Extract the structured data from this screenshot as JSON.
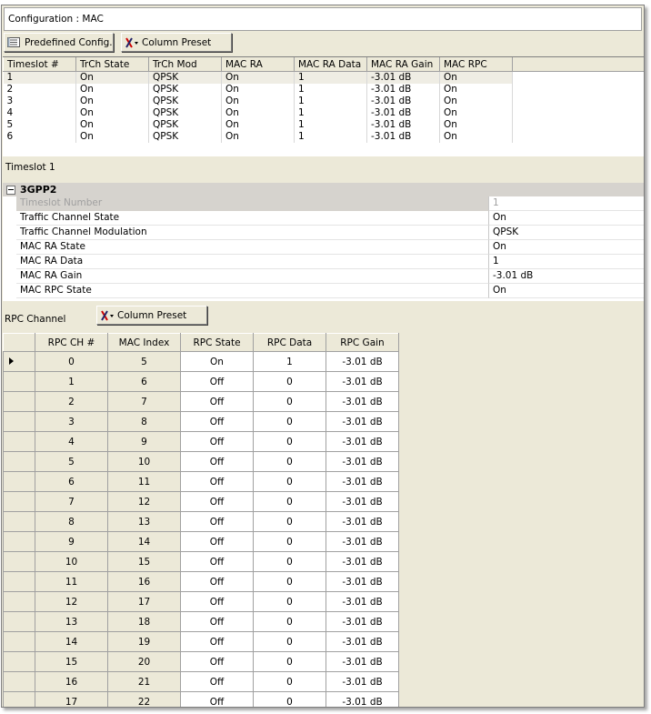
{
  "config": {
    "title": "Configuration : MAC"
  },
  "toolbar": {
    "predefined_label": "Predefined Config.",
    "column_preset_label": "Column Preset"
  },
  "mac_table": {
    "columns": [
      "Timeslot #",
      "TrCh State",
      "TrCh Mod",
      "MAC RA",
      "MAC RA Data",
      "MAC RA Gain",
      "MAC RPC"
    ],
    "rows": [
      [
        "1",
        "On",
        "QPSK",
        "On",
        "1",
        "-3.01 dB",
        "On"
      ],
      [
        "2",
        "On",
        "QPSK",
        "On",
        "1",
        "-3.01 dB",
        "On"
      ],
      [
        "3",
        "On",
        "QPSK",
        "On",
        "1",
        "-3.01 dB",
        "On"
      ],
      [
        "4",
        "On",
        "QPSK",
        "On",
        "1",
        "-3.01 dB",
        "On"
      ],
      [
        "5",
        "On",
        "QPSK",
        "On",
        "1",
        "-3.01 dB",
        "On"
      ],
      [
        "6",
        "On",
        "QPSK",
        "On",
        "1",
        "-3.01 dB",
        "On"
      ]
    ]
  },
  "timeslot_label": "Timeslot 1",
  "properties": {
    "category": "3GPP2",
    "rows": [
      {
        "key": "Timeslot Number",
        "value": "1",
        "disabled": true
      },
      {
        "key": "Traffic Channel State",
        "value": "On"
      },
      {
        "key": "Traffic Channel Modulation",
        "value": "QPSK"
      },
      {
        "key": "MAC RA State",
        "value": "On"
      },
      {
        "key": "MAC RA Data",
        "value": "1"
      },
      {
        "key": "MAC RA Gain",
        "value": "-3.01 dB"
      },
      {
        "key": "MAC RPC State",
        "value": "On"
      }
    ]
  },
  "rpc": {
    "label": "RPC Channel",
    "column_preset_label": "Column Preset",
    "columns": [
      "RPC CH #",
      "MAC Index",
      "RPC State",
      "RPC Data",
      "RPC Gain"
    ],
    "rows": [
      [
        "0",
        "5",
        "On",
        "1",
        "-3.01 dB"
      ],
      [
        "1",
        "6",
        "Off",
        "0",
        "-3.01 dB"
      ],
      [
        "2",
        "7",
        "Off",
        "0",
        "-3.01 dB"
      ],
      [
        "3",
        "8",
        "Off",
        "0",
        "-3.01 dB"
      ],
      [
        "4",
        "9",
        "Off",
        "0",
        "-3.01 dB"
      ],
      [
        "5",
        "10",
        "Off",
        "0",
        "-3.01 dB"
      ],
      [
        "6",
        "11",
        "Off",
        "0",
        "-3.01 dB"
      ],
      [
        "7",
        "12",
        "Off",
        "0",
        "-3.01 dB"
      ],
      [
        "8",
        "13",
        "Off",
        "0",
        "-3.01 dB"
      ],
      [
        "9",
        "14",
        "Off",
        "0",
        "-3.01 dB"
      ],
      [
        "10",
        "15",
        "Off",
        "0",
        "-3.01 dB"
      ],
      [
        "11",
        "16",
        "Off",
        "0",
        "-3.01 dB"
      ],
      [
        "12",
        "17",
        "Off",
        "0",
        "-3.01 dB"
      ],
      [
        "13",
        "18",
        "Off",
        "0",
        "-3.01 dB"
      ],
      [
        "14",
        "19",
        "Off",
        "0",
        "-3.01 dB"
      ],
      [
        "15",
        "20",
        "Off",
        "0",
        "-3.01 dB"
      ],
      [
        "16",
        "21",
        "Off",
        "0",
        "-3.01 dB"
      ],
      [
        "17",
        "22",
        "Off",
        "0",
        "-3.01 dB"
      ]
    ]
  }
}
